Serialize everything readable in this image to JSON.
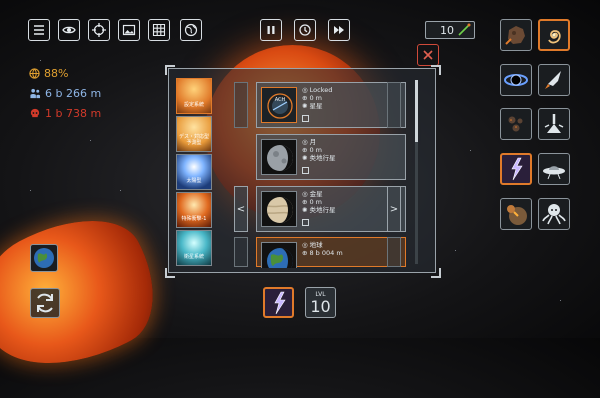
{
  "toolbar": {
    "left_buttons": [
      "menu-icon",
      "eye-icon",
      "crosshair-icon",
      "image-icon",
      "grid-icon",
      "globe-icon"
    ],
    "center_buttons": [
      "pause-icon",
      "clock-icon",
      "fast-forward-icon"
    ],
    "counter_value": "10"
  },
  "stats": {
    "integrity": "88%",
    "population": "6 b 266 m",
    "deaths": "1 b 738 m"
  },
  "colors": {
    "accent": "#e07a2a",
    "integrity": "#e0a030",
    "population": "#8fb6e6",
    "deaths": "#d23a2a",
    "close": "#d04a3a"
  },
  "categories": [
    {
      "label": "設定系統"
    },
    {
      "label": "デス・対応型 予測型"
    },
    {
      "label": "太陽型"
    },
    {
      "label": "特殊衝撃-1"
    },
    {
      "label": "衛星系統"
    }
  ],
  "objects": [
    {
      "name": "Locked",
      "mass": "0 m",
      "type": "星星",
      "thumb": "lock-planet-icon",
      "active": false
    },
    {
      "name": "月",
      "mass": "0 m",
      "type": "类地行星",
      "thumb": "moon-icon",
      "active": false
    },
    {
      "name": "金星",
      "mass": "0 m",
      "type": "类地行星",
      "thumb": "venus-icon",
      "active": false
    },
    {
      "name": "地球",
      "mass": "8 b 004 m",
      "type": "",
      "thumb": "earth-icon",
      "active": true
    }
  ],
  "nav": {
    "prev": "<",
    "next": ">"
  },
  "right_tools": [
    "asteroid-icon",
    "spiral-galaxy-icon",
    "black-hole-icon",
    "rocket-icon",
    "meteors-icon",
    "laser-cannon-icon",
    "lightning-icon",
    "ufo-icon",
    "planet-crash-icon",
    "octopus-icon"
  ],
  "bottom": {
    "level_label": "LVL",
    "level_value": "10"
  }
}
